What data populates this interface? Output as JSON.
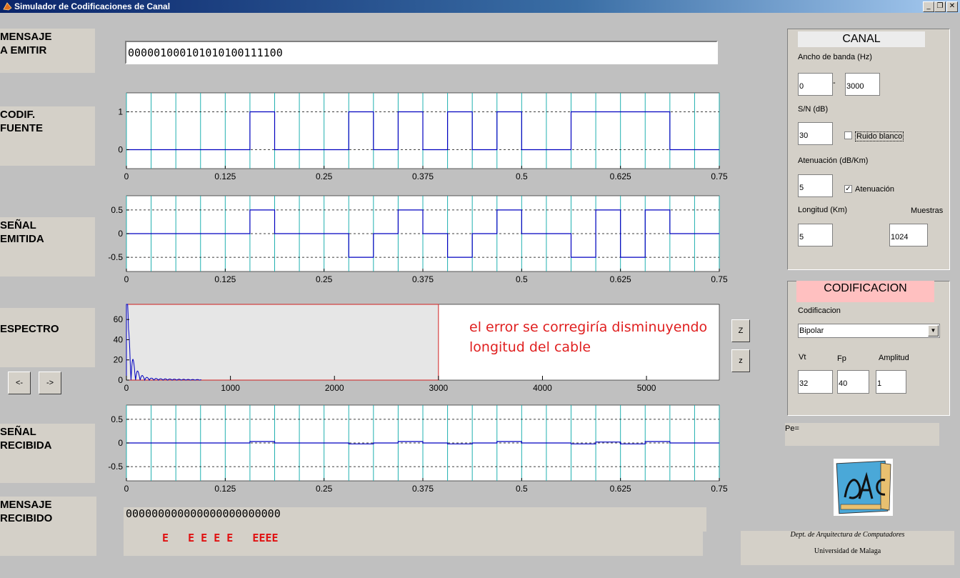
{
  "window": {
    "title": "Simulador de Codificaciones de Canal",
    "controls": [
      "_",
      "❐",
      "✕"
    ]
  },
  "labels": {
    "mensaje_emitir": "MENSAJE\nA EMITIR",
    "codif_fuente": "CODIF.\nFUENTE",
    "senal_emitida": "SEÑAL\nEMITIDA",
    "espectro": "ESPECTRO",
    "senal_recibida": "SEÑAL\nRECIBIDA",
    "mensaje_recibido": "MENSAJE\nRECIBIDO"
  },
  "message_input": "000001000101010100111100",
  "received_message": "000000000000000000000000",
  "error_marks": "E   E E E E   EEEE",
  "annotation": [
    "el error se corregiría disminuyendo",
    "longitud del cable"
  ],
  "spectrum_nav": {
    "prev": "<-",
    "next": "->"
  },
  "zoom_buttons": [
    "Z",
    "z"
  ],
  "time_ticks": [
    "0",
    "0.125",
    "0.25",
    "0.375",
    "0.5",
    "0.625",
    "0.75"
  ],
  "bits": [
    0,
    0,
    0,
    0,
    0,
    1,
    0,
    0,
    0,
    1,
    0,
    1,
    0,
    1,
    0,
    1,
    0,
    0,
    1,
    1,
    1,
    1,
    0,
    0
  ],
  "canal": {
    "title": "CANAL",
    "ancho_label": "Ancho de banda (Hz)",
    "ancho_min": "0",
    "ancho_sep": "-",
    "ancho_max": "3000",
    "sn_label": "S/N (dB)",
    "sn_value": "30",
    "ruido_label": "Ruido blanco",
    "ruido_checked": false,
    "aten_label": "Atenuación (dB/Km)",
    "aten_value": "5",
    "aten_check_label": "Atenuación",
    "aten_checked": true,
    "longitud_label": "Longitud (Km)",
    "longitud_value": "5",
    "muestras_label": "Muestras",
    "muestras_value": "1024"
  },
  "codificacion": {
    "title": "CODIFICACION",
    "label": "Codificacion",
    "selected": "Bipolar",
    "vt_label": "Vt",
    "vt_value": "32",
    "fp_label": "Fp",
    "fp_value": "40",
    "amp_label": "Amplitud",
    "amp_value": "1"
  },
  "pe_label": "Pe=",
  "credits": {
    "line1": "Dept. de Arquitectura de Computadores",
    "line2": "Universidad de Malaga"
  },
  "chart_data": [
    {
      "type": "line",
      "name": "codif_fuente",
      "xlim": [
        0,
        0.75
      ],
      "ylim": [
        -0.5,
        1.5
      ],
      "yticks": [
        "1",
        "0"
      ],
      "x_step": 0.03125,
      "values": [
        0,
        0,
        0,
        0,
        0,
        1,
        0,
        0,
        0,
        1,
        0,
        1,
        0,
        1,
        0,
        1,
        0,
        0,
        1,
        1,
        1,
        1,
        0,
        0
      ]
    },
    {
      "type": "line",
      "name": "senal_emitida",
      "xlim": [
        0,
        0.75
      ],
      "ylim": [
        -0.8,
        0.8
      ],
      "yticks": [
        "0.5",
        "0",
        "-0.5"
      ],
      "x_step": 0.03125,
      "values": [
        0,
        0,
        0,
        0,
        0,
        0.5,
        0,
        0,
        0,
        -0.5,
        0,
        0.5,
        0,
        -0.5,
        0,
        0.5,
        0,
        0,
        -0.5,
        0.5,
        -0.5,
        0.5,
        0,
        0
      ]
    },
    {
      "type": "area",
      "name": "espectro",
      "xlim": [
        0,
        5700
      ],
      "ylim": [
        0,
        75
      ],
      "xticks": [
        "0",
        "1000",
        "2000",
        "3000",
        "4000",
        "5000"
      ],
      "yticks": [
        "60",
        "40",
        "20",
        "0"
      ],
      "band_hz": [
        0,
        3000
      ],
      "peak": 75
    },
    {
      "type": "line",
      "name": "senal_recibida",
      "xlim": [
        0,
        0.75
      ],
      "ylim": [
        -0.8,
        0.8
      ],
      "yticks": [
        "0.5",
        "0",
        "-0.5"
      ],
      "x_step": 0.03125,
      "values": [
        0,
        0,
        0,
        0,
        0,
        0.03,
        0,
        0,
        0,
        -0.02,
        0,
        0.03,
        0,
        -0.02,
        0,
        0.03,
        0,
        0,
        -0.02,
        0.02,
        -0.02,
        0.03,
        0,
        0
      ]
    }
  ]
}
